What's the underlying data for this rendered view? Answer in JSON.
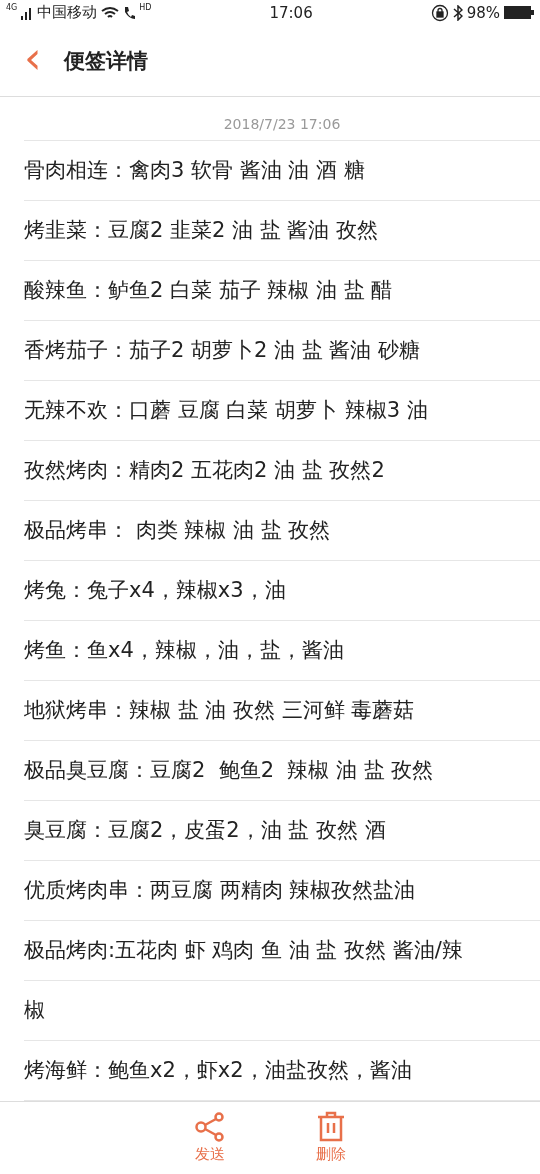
{
  "status_bar": {
    "network": "4G",
    "carrier": "中国移动",
    "call_badge": "HD",
    "time": "17:06",
    "battery": "98%"
  },
  "header": {
    "back": "‹",
    "title": "便签详情"
  },
  "note": {
    "date": "2018/7/23 17:06",
    "lines": [
      "骨肉相连：禽肉3 软骨 酱油 油 酒 糖",
      "烤韭菜：豆腐2 韭菜2 油 盐 酱油 孜然",
      "酸辣鱼：鲈鱼2 白菜 茄子 辣椒 油 盐 醋",
      "香烤茄子：茄子2 胡萝卜2 油 盐 酱油 砂糖",
      "无辣不欢：口蘑 豆腐 白菜 胡萝卜 辣椒3 油",
      "孜然烤肉：精肉2 五花肉2 油 盐 孜然2",
      "极品烤串： 肉类 辣椒 油 盐 孜然",
      "烤兔：兔子x4，辣椒x3，油",
      "烤鱼：鱼x4，辣椒，油，盐，酱油",
      "地狱烤串：辣椒 盐 油 孜然 三河鲜 毒蘑菇",
      "极品臭豆腐：豆腐2  鲍鱼2  辣椒 油 盐 孜然",
      "臭豆腐：豆腐2，皮蛋2，油 盐 孜然 酒",
      "优质烤肉串：两豆腐 两精肉 辣椒孜然盐油",
      "极品烤肉:五花肉 虾 鸡肉 鱼 油 盐 孜然 酱油/辣",
      "椒",
      "烤海鲜：鲍鱼x2，虾x2，油盐孜然，酱油"
    ]
  },
  "actions": [
    {
      "kind": "share",
      "label": "发送"
    },
    {
      "kind": "delete",
      "label": "删除"
    }
  ]
}
